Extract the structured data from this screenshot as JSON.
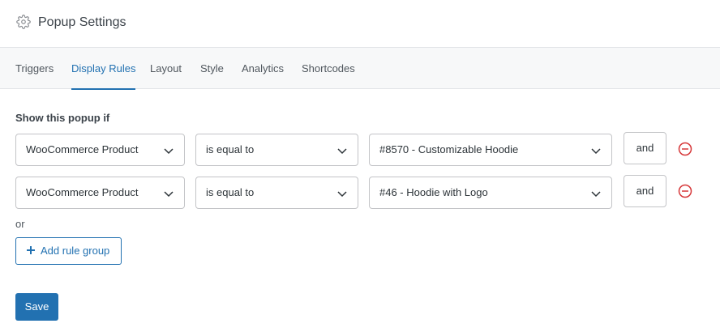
{
  "header": {
    "title": "Popup Settings",
    "icon": "gear-icon"
  },
  "tabs": [
    {
      "label": "Triggers",
      "active": false
    },
    {
      "label": "Display Rules",
      "active": true
    },
    {
      "label": "Layout",
      "active": false
    },
    {
      "label": "Style",
      "active": false
    },
    {
      "label": "Analytics",
      "active": false
    },
    {
      "label": "Shortcodes",
      "active": false
    }
  ],
  "rules": {
    "heading": "Show this popup if",
    "rows": [
      {
        "type": "WooCommerce Product",
        "operator": "is equal to",
        "value": "#8570 - Customizable Hoodie",
        "conjunction": "and"
      },
      {
        "type": "WooCommerce Product",
        "operator": "is equal to",
        "value": "#46 - Hoodie with Logo",
        "conjunction": "and"
      }
    ],
    "or_label": "or",
    "add_group_label": "Add rule group"
  },
  "save_label": "Save",
  "colors": {
    "accent": "#2271b1",
    "remove": "#d63638",
    "border": "#c3c4c7"
  }
}
